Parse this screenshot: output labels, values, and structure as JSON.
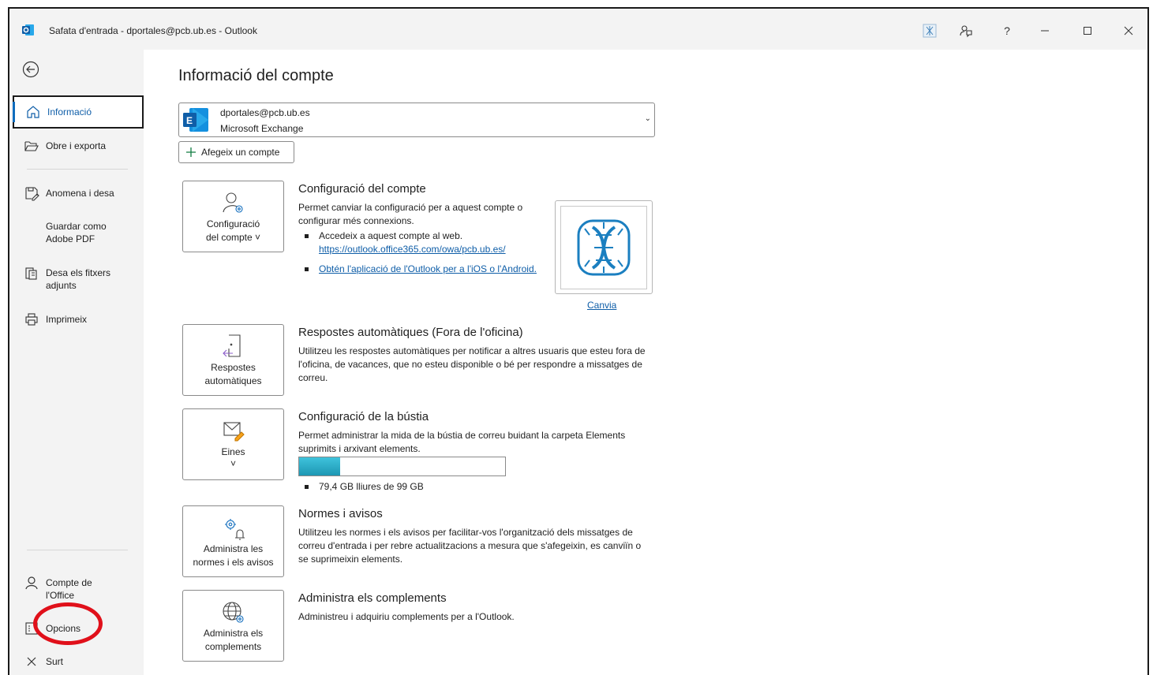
{
  "window": {
    "title": "Safata d'entrada - dportales@pcb.ub.es - Outlook",
    "help_label": "?"
  },
  "sidebar": {
    "items": [
      {
        "label": "Informació"
      },
      {
        "label": "Obre i exporta"
      },
      {
        "label": "Anomena i desa"
      },
      {
        "label": "Guardar como Adobe PDF"
      },
      {
        "label": "Desa els fitxers adjunts"
      },
      {
        "label": "Imprimeix"
      },
      {
        "label": "Compte de l'Office"
      },
      {
        "label": "Opcions"
      },
      {
        "label": "Surt"
      }
    ]
  },
  "main": {
    "page_title": "Informació del compte",
    "account": {
      "email": "dportales@pcb.ub.es",
      "type": "Microsoft Exchange"
    },
    "add_account_label": "Afegeix un compte",
    "sections": [
      {
        "tile_label_1": "Configuració",
        "tile_label_2": "del compte ˅",
        "title": "Configuració del compte",
        "desc": "Permet canviar la configuració per a aquest compte o configurar més connexions.",
        "bullet1": "Accedeix a aquest compte al web.",
        "link1": "https://outlook.office365.com/owa/pcb.ub.es/",
        "link2": "Obtén l'aplicació de l'Outlook per a l'iOS o l'Android.",
        "change_label": "Canvia"
      },
      {
        "tile_label_1": "Respostes",
        "tile_label_2": "automàtiques",
        "title": "Respostes automàtiques (Fora de l'oficina)",
        "desc": "Utilitzeu les respostes automàtiques per notificar a altres usuaris que esteu fora de l'oficina, de vacances, que no esteu disponible o bé per respondre a missatges de correu."
      },
      {
        "tile_label_1": "Eines",
        "tile_label_2": "˅",
        "title": "Configuració de la bústia",
        "desc": "Permet administrar la mida de la bústia de correu buidant la carpeta Elements suprimits i arxivant elements.",
        "storage_text": "79,4 GB lliures de 99 GB",
        "storage_used_fraction": 0.2
      },
      {
        "tile_label_1": "Administra les",
        "tile_label_2": "normes i els avisos",
        "title": "Normes i avisos",
        "desc": "Utilitzeu les normes i els avisos per facilitar-vos l'organització dels missatges de correu d'entrada i per rebre actualitzacions a mesura que s'afegeixin, es canviïn o se suprimeixin elements."
      },
      {
        "tile_label_1": "Administra els",
        "tile_label_2": "complements",
        "title": "Administra els complements",
        "desc": "Administreu i adquiriu complements per a l'Outlook."
      }
    ]
  },
  "colors": {
    "accent": "#0f6cbd",
    "link": "#0f5ea8",
    "highlight": "#e0101a",
    "storage_fill": "#27adc9"
  }
}
